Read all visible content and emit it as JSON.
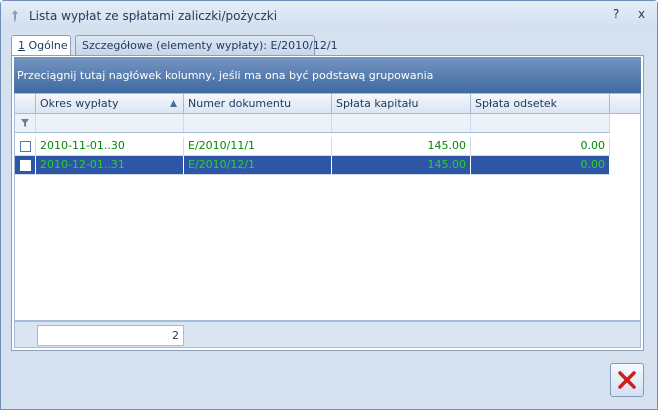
{
  "window": {
    "title": "Lista wypłat ze spłatami zaliczki/pożyczki",
    "help_label": "?",
    "close_label": "x"
  },
  "tabs": [
    {
      "label": "1 Ogólne",
      "active": true
    },
    {
      "label": "Szczegółowe (elementy wypłaty): E/2010/12/1",
      "active": false
    }
  ],
  "group_panel": {
    "text": "Przeciągnij tutaj nagłówek kolumny, jeśli ma ona być podstawą grupowania"
  },
  "columns": [
    {
      "label": "Okres wypłaty",
      "sort": "ascending"
    },
    {
      "label": "Numer dokumentu"
    },
    {
      "label": "Spłata kapitału"
    },
    {
      "label": "Spłata odsetek"
    }
  ],
  "rows": [
    {
      "period": "2010-11-01..30",
      "document": "E/2010/11/1",
      "capital": "145.00",
      "interest": "0.00",
      "checked": false,
      "selected": false
    },
    {
      "period": "2010-12-01..31",
      "document": "E/2010/12/1",
      "capital": "145.00",
      "interest": "0.00",
      "checked": false,
      "selected": true
    }
  ],
  "footer": {
    "count": "2"
  },
  "colors": {
    "title_text": "#1e395b",
    "group_panel": "#3f6aa3",
    "selected_row": "#2d57a6",
    "row_text": "#008a00",
    "close_x": "#d21c1c"
  }
}
